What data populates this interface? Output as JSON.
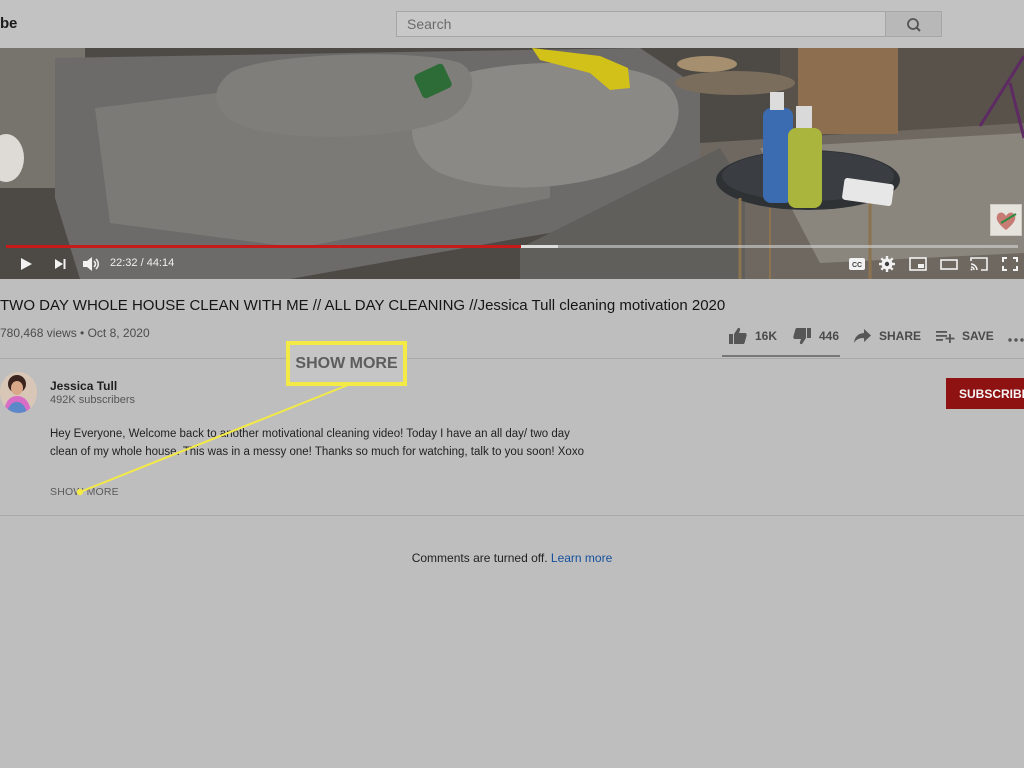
{
  "header": {
    "logo_fragment": "be",
    "search_placeholder": "Search"
  },
  "player": {
    "time_display": "22:32 / 44:14",
    "played_fraction": 0.509,
    "buffered_fraction": 0.545,
    "controls": [
      "play-icon",
      "next-icon",
      "volume-icon",
      "captions-icon",
      "settings-icon",
      "miniplayer-icon",
      "theater-mode-icon",
      "cast-icon",
      "fullscreen-icon"
    ]
  },
  "video": {
    "title": "TWO DAY WHOLE HOUSE CLEAN WITH ME // ALL DAY CLEANING //Jessica Tull cleaning motivation 2020",
    "meta": "780,468 views • Oct 8, 2020"
  },
  "actions": {
    "like_count": "16K",
    "dislike_count": "446",
    "share_label": "SHARE",
    "save_label": "SAVE"
  },
  "channel": {
    "name": "Jessica Tull",
    "subscribers": "492K subscribers",
    "subscribe_label": "SUBSCRIBE"
  },
  "description": {
    "text": "Hey Everyone, Welcome back to another motivational cleaning video! Today I have an all day/ two day clean of my whole house. This was in a messy one! Thanks so much for watching, talk to you soon! Xoxo",
    "show_more_label": "SHOW MORE"
  },
  "callout": {
    "label": "SHOW MORE",
    "color": "#f4ea45"
  },
  "comments": {
    "message": "Comments are turned off.",
    "learn_more_label": "Learn more"
  },
  "colors": {
    "subscribe_red": "#8f1212",
    "progress_red": "#c71a1a",
    "link_blue": "#15509d",
    "callout_yellow": "#f4ea45"
  }
}
